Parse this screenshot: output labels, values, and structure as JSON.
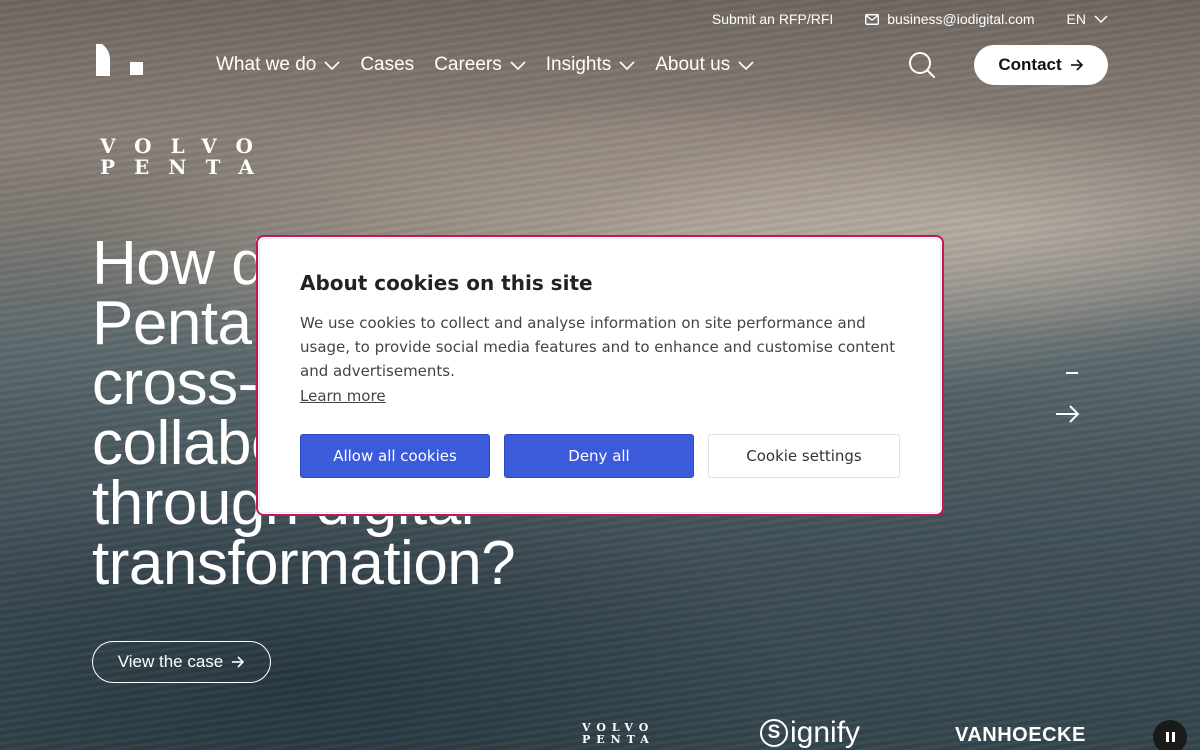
{
  "utility_bar": {
    "rfp_label": "Submit an RFP/RFI",
    "email": "business@iodigital.com",
    "language": "EN"
  },
  "nav": {
    "items": [
      {
        "label": "What we do",
        "has_dropdown": true
      },
      {
        "label": "Cases",
        "has_dropdown": false
      },
      {
        "label": "Careers",
        "has_dropdown": true
      },
      {
        "label": "Insights",
        "has_dropdown": true
      },
      {
        "label": "About us",
        "has_dropdown": true
      }
    ],
    "contact_label": "Contact"
  },
  "hero": {
    "brand_logo": [
      "VOLVO",
      "PENTA"
    ],
    "title_lines": [
      "How did Volvo",
      "Penta achieve",
      "cross-functional",
      "collaboration",
      "through digital",
      "transformation?"
    ],
    "cta_label": "View the case"
  },
  "clients": {
    "volvo": [
      "VOLVO",
      "PENTA"
    ],
    "signify": "ignify",
    "signify_mark": "S",
    "vanhoecke": "VANHOECKE"
  },
  "cookie_banner": {
    "title": "About cookies on this site",
    "body": "We use cookies to collect and analyse information on site performance and usage, to provide social media features and to enhance and customise content and advertisements.",
    "learn_more": "Learn more",
    "allow_all": "Allow all cookies",
    "deny_all": "Deny all",
    "settings": "Cookie settings"
  },
  "colors": {
    "accent_button": "#3b5bdb",
    "modal_outline": "#c2185b"
  }
}
